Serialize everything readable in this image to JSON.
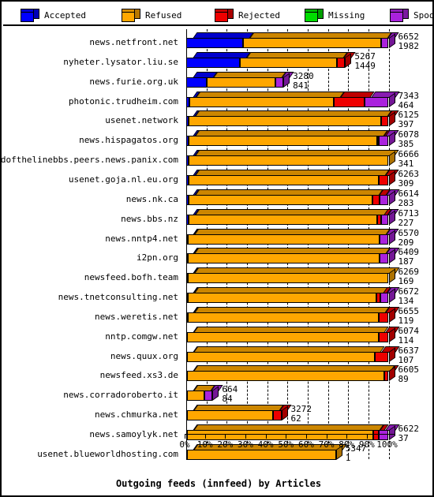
{
  "legend": {
    "items": [
      {
        "label": "Accepted",
        "color": "#0000ff",
        "icon": "cube-icon"
      },
      {
        "label": "Refused",
        "color": "#ffa700",
        "icon": "cube-icon"
      },
      {
        "label": "Rejected",
        "color": "#ee0000",
        "icon": "cube-icon"
      },
      {
        "label": "Missing",
        "color": "#00dd00",
        "icon": "cube-icon"
      },
      {
        "label": "Spooled",
        "color": "#aa22dd",
        "icon": "cube-icon"
      }
    ]
  },
  "chart_data": {
    "type": "bar",
    "orientation": "horizontal",
    "stacked": true,
    "percent_stacked": true,
    "title": "Outgoing feeds (innfeed) by Articles",
    "xlabel": "Outgoing feeds (innfeed) by Articles",
    "ylabel": "",
    "xlim": [
      0,
      100
    ],
    "xticks": [
      "0%",
      "10%",
      "20%",
      "30%",
      "40%",
      "50%",
      "60%",
      "70%",
      "80%",
      "90%",
      "100%"
    ],
    "grid": true,
    "legend_position": "top",
    "series": [
      {
        "name": "Accepted",
        "color": "#0000ff"
      },
      {
        "name": "Refused",
        "color": "#ffa700"
      },
      {
        "name": "Rejected",
        "color": "#ee0000"
      },
      {
        "name": "Missing",
        "color": "#00dd00"
      },
      {
        "name": "Spooled",
        "color": "#aa22dd"
      }
    ],
    "categories": [
      "news.netfront.net",
      "nyheter.lysator.liu.se",
      "news.furie.org.uk",
      "photonic.trudheim.com",
      "usenet.network",
      "news.hispagatos.org",
      "endofthelinebbs.peers.news.panix.com",
      "usenet.goja.nl.eu.org",
      "news.nk.ca",
      "news.bbs.nz",
      "news.nntp4.net",
      "i2pn.org",
      "newsfeed.bofh.team",
      "news.tnetconsulting.net",
      "news.weretis.net",
      "nntp.comgw.net",
      "news.quux.org",
      "newsfeed.xs3.de",
      "news.corradoroberto.it",
      "news.chmurka.net",
      "news.samoylyk.net",
      "usenet.blueworldhosting.com"
    ],
    "rows": [
      {
        "category": "news.netfront.net",
        "total": 6652,
        "value2": 1982,
        "pct": [
          28.0,
          68.4,
          0.0,
          0.0,
          3.6
        ]
      },
      {
        "category": "nyheter.lysator.liu.se",
        "total": 5267,
        "value2": 1449,
        "pct": [
          26.5,
          48.0,
          4.0,
          0.0,
          0.0
        ]
      },
      {
        "category": "news.furie.org.uk",
        "total": 3280,
        "value2": 841,
        "pct": [
          10.0,
          34.0,
          0.0,
          0.0,
          4.0
        ]
      },
      {
        "category": "photonic.trudheim.com",
        "total": 7343,
        "value2": 464,
        "pct": [
          1.6,
          71.4,
          15.0,
          0.0,
          12.0
        ]
      },
      {
        "category": "usenet.network",
        "total": 6125,
        "value2": 397,
        "pct": [
          1.3,
          95.0,
          3.7,
          0.0,
          0.0
        ]
      },
      {
        "category": "news.hispagatos.org",
        "total": 6078,
        "value2": 385,
        "pct": [
          1.3,
          93.0,
          1.0,
          0.0,
          4.7
        ]
      },
      {
        "category": "endofthelinebbs.peers.news.panix.com",
        "total": 6666,
        "value2": 341,
        "pct": [
          1.2,
          98.8,
          0.0,
          0.0,
          0.0
        ]
      },
      {
        "category": "usenet.goja.nl.eu.org",
        "total": 6263,
        "value2": 309,
        "pct": [
          1.2,
          94.0,
          4.8,
          0.0,
          0.0
        ]
      },
      {
        "category": "news.nk.ca",
        "total": 6614,
        "value2": 283,
        "pct": [
          1.1,
          91.0,
          3.4,
          0.0,
          4.5
        ]
      },
      {
        "category": "news.bbs.nz",
        "total": 6713,
        "value2": 227,
        "pct": [
          1.0,
          93.5,
          1.8,
          0.0,
          3.7
        ]
      },
      {
        "category": "news.nntp4.net",
        "total": 6570,
        "value2": 209,
        "pct": [
          0.9,
          94.7,
          0.0,
          0.0,
          4.4
        ]
      },
      {
        "category": "i2pn.org",
        "total": 6409,
        "value2": 187,
        "pct": [
          0.8,
          94.6,
          0.0,
          0.0,
          4.6
        ]
      },
      {
        "category": "newsfeed.bofh.team",
        "total": 6269,
        "value2": 169,
        "pct": [
          0.7,
          99.3,
          0.0,
          0.0,
          0.0
        ]
      },
      {
        "category": "news.tnetconsulting.net",
        "total": 6672,
        "value2": 134,
        "pct": [
          0.6,
          93.4,
          1.8,
          0.0,
          4.2
        ]
      },
      {
        "category": "news.weretis.net",
        "total": 6655,
        "value2": 119,
        "pct": [
          0.6,
          94.4,
          5.0,
          0.0,
          0.0
        ]
      },
      {
        "category": "nntp.comgw.net",
        "total": 6074,
        "value2": 114,
        "pct": [
          0.5,
          94.5,
          5.0,
          0.0,
          0.0
        ]
      },
      {
        "category": "news.quux.org",
        "total": 6637,
        "value2": 107,
        "pct": [
          0.5,
          92.5,
          7.0,
          0.0,
          0.0
        ]
      },
      {
        "category": "newsfeed.xs3.de",
        "total": 6605,
        "value2": 89,
        "pct": [
          0.5,
          97.5,
          2.0,
          0.0,
          0.0
        ]
      },
      {
        "category": "news.corradoroberto.it",
        "total": 664,
        "value2": 84,
        "pct": [
          0.4,
          8.6,
          0.0,
          0.0,
          4.0
        ]
      },
      {
        "category": "news.chmurka.net",
        "total": 3272,
        "value2": 62,
        "pct": [
          0.4,
          42.6,
          4.0,
          0.0,
          0.0
        ]
      },
      {
        "category": "news.samoylyk.net",
        "total": 6622,
        "value2": 37,
        "pct": [
          0.3,
          92.2,
          2.5,
          0.0,
          5.0
        ]
      },
      {
        "category": "usenet.blueworldhosting.com",
        "total": 5347,
        "value2": 1,
        "pct": [
          0.2,
          73.8,
          0.0,
          0.0,
          0.0
        ]
      }
    ]
  }
}
